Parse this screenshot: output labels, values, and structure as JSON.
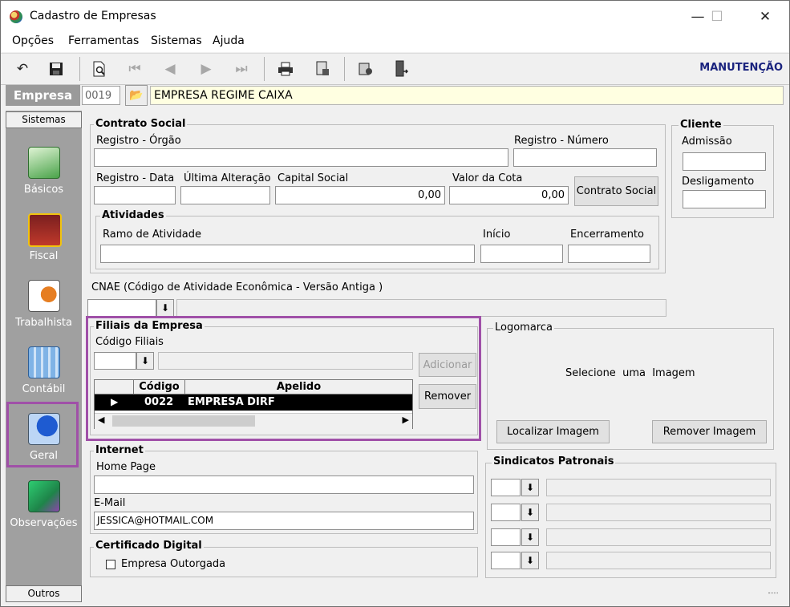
{
  "window": {
    "title": "Cadastro de Empresas",
    "minimize": "—",
    "maximize": "☐",
    "close": "✕"
  },
  "menu": [
    "Opções",
    "Ferramentas",
    "Sistemas",
    "Ajuda"
  ],
  "toolbar": {
    "mode_label": "MANUTENÇÃO"
  },
  "empresa": {
    "label": "Empresa",
    "code": "0019",
    "name": "EMPRESA REGIME CAIXA"
  },
  "sidebar": {
    "header": "Sistemas",
    "footer": "Outros",
    "items": [
      {
        "label": "Básicos",
        "icon": "basicos-icon"
      },
      {
        "label": "Fiscal",
        "icon": "fiscal-icon"
      },
      {
        "label": "Trabalhista",
        "icon": "trabalhista-icon"
      },
      {
        "label": "Contábil",
        "icon": "contabil-icon"
      },
      {
        "label": "Geral",
        "icon": "geral-info-icon"
      },
      {
        "label": "Observações",
        "icon": "observacoes-icon"
      }
    ]
  },
  "contrato": {
    "title": "Contrato Social",
    "registro_orgao_label": "Registro - Órgão",
    "registro_numero_label": "Registro - Número",
    "registro_data_label": "Registro - Data",
    "ultima_alteracao_label": "Última Alteração",
    "capital_social_label": "Capital Social",
    "capital_social_value": "0,00",
    "valor_cota_label": "Valor da Cota",
    "valor_cota_value": "0,00",
    "contrato_button": "Contrato Social"
  },
  "atividades": {
    "title": "Atividades",
    "ramo_label": "Ramo de Atividade",
    "inicio_label": "Início",
    "encerramento_label": "Encerramento"
  },
  "cliente": {
    "title": "Cliente",
    "admissao_label": "Admissão",
    "desligamento_label": "Desligamento"
  },
  "cnae": {
    "label": "CNAE (Código de Atividade Econômica - Versão Antiga )"
  },
  "filiais": {
    "title": "Filiais da Empresa",
    "codigo_label": "Código Filiais",
    "adicionar_button": "Adicionar",
    "remover_button": "Remover",
    "columns": [
      "Código",
      "Apelido"
    ],
    "rows": [
      {
        "codigo": "0022",
        "apelido": "EMPRESA DIRF"
      }
    ]
  },
  "logomarca": {
    "title": "Logomarca",
    "placeholder": "Selecione  uma  Imagem",
    "localizar_button": "Localizar Imagem",
    "remover_button": "Remover Imagem"
  },
  "internet": {
    "title": "Internet",
    "homepage_label": "Home Page",
    "homepage_value": "",
    "email_label": "E-Mail",
    "email_value": "JESSICA@HOTMAIL.COM"
  },
  "certificado": {
    "title": "Certificado Digital",
    "outorgada_label": "Empresa Outorgada",
    "outorgada_checked": false
  },
  "sindicatos": {
    "title": "Sindicatos Patronais",
    "rows": 4
  }
}
